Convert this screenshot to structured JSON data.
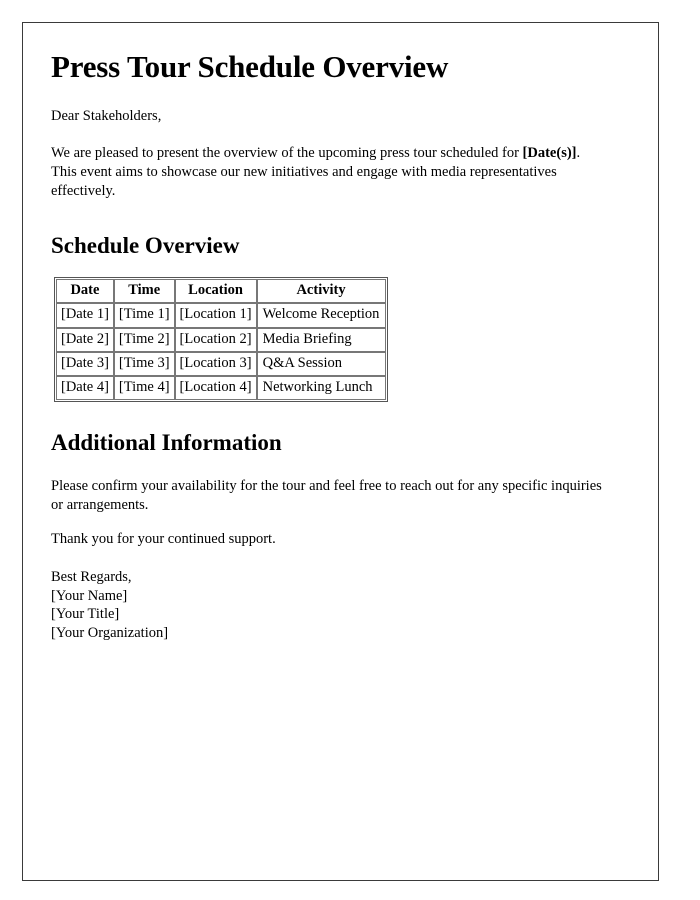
{
  "document": {
    "title": "Press Tour Schedule Overview",
    "salutation": "Dear Stakeholders,",
    "intro": {
      "before_bold": "We are pleased to present the overview of the upcoming press tour scheduled for ",
      "bold": "[Date(s)]",
      "after_bold": ". This event aims to showcase our new initiatives and engage with media representatives effectively."
    },
    "schedule_section": {
      "heading": "Schedule Overview",
      "table": {
        "columns": [
          "Date",
          "Time",
          "Location",
          "Activity"
        ],
        "rows": [
          [
            "[Date 1]",
            "[Time 1]",
            "[Location 1]",
            "Welcome Reception"
          ],
          [
            "[Date 2]",
            "[Time 2]",
            "[Location 2]",
            "Media Briefing"
          ],
          [
            "[Date 3]",
            "[Time 3]",
            "[Location 3]",
            "Q&A Session"
          ],
          [
            "[Date 4]",
            "[Time 4]",
            "[Location 4]",
            "Networking Lunch"
          ]
        ]
      }
    },
    "additional_section": {
      "heading": "Additional Information",
      "paragraph_1": "Please confirm your availability for the tour and feel free to reach out for any specific inquiries or arrangements.",
      "paragraph_2": "Thank you for your continued support."
    },
    "signature": {
      "closing": "Best Regards,",
      "name": "[Your Name]",
      "title": "[Your Title]",
      "organization": "[Your Organization]"
    }
  }
}
